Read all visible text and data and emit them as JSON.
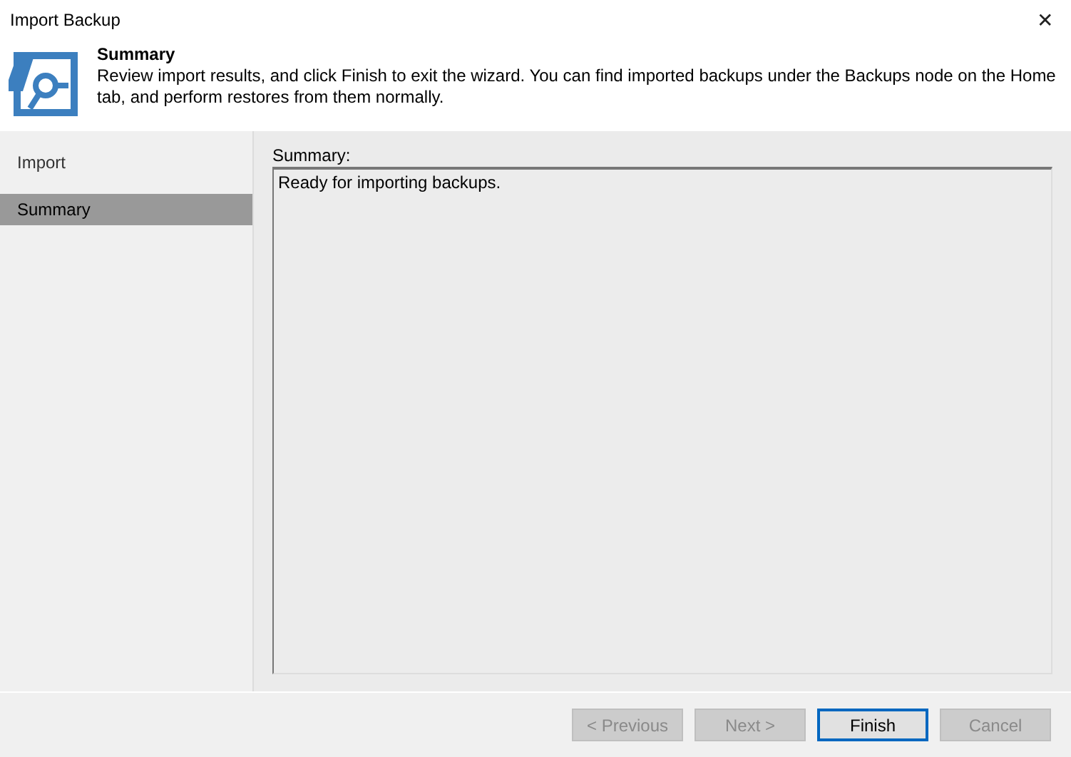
{
  "window": {
    "title": "Import Backup",
    "close": "✕"
  },
  "header": {
    "title": "Summary",
    "description": "Review import results, and click Finish to exit the wizard. You can find imported backups under the Backups node on the Home tab, and perform restores from them normally."
  },
  "steps": [
    {
      "label": "Import",
      "selected": false
    },
    {
      "label": "Summary",
      "selected": true
    }
  ],
  "summary": {
    "label": "Summary:",
    "text": "Ready for importing backups."
  },
  "buttons": [
    {
      "label": "< Previous",
      "disabled": true,
      "default": false
    },
    {
      "label": "Next >",
      "disabled": true,
      "default": false
    },
    {
      "label": "Finish",
      "disabled": false,
      "default": true
    },
    {
      "label": "Cancel",
      "disabled": true,
      "default": false
    }
  ]
}
